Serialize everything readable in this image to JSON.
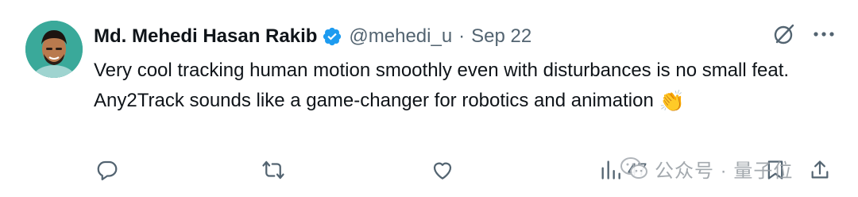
{
  "tweet": {
    "author": {
      "display_name": "Md. Mehedi Hasan Rakib",
      "handle": "@mehedi_u",
      "verified": true,
      "avatar": "avatar-photo"
    },
    "separator": "·",
    "date": "Sep 22",
    "text": "Very cool tracking human motion smoothly even with disturbances is no small feat. Any2Track sounds like a game-changer for robotics and animation",
    "emoji": "👏",
    "views": "47"
  },
  "icons": {
    "verified": "verified-badge-icon",
    "grok": "grok-icon",
    "more": "more-icon",
    "reply": "reply-icon",
    "retweet": "retweet-icon",
    "like": "like-icon",
    "views": "views-icon",
    "bookmark": "bookmark-icon",
    "share": "share-icon",
    "wechat": "wechat-icon"
  },
  "watermark": {
    "text": "公众号 · 量子位"
  },
  "colors": {
    "verified_blue": "#1d9bf0",
    "secondary_text": "#536471",
    "primary_text": "#0f1419"
  }
}
